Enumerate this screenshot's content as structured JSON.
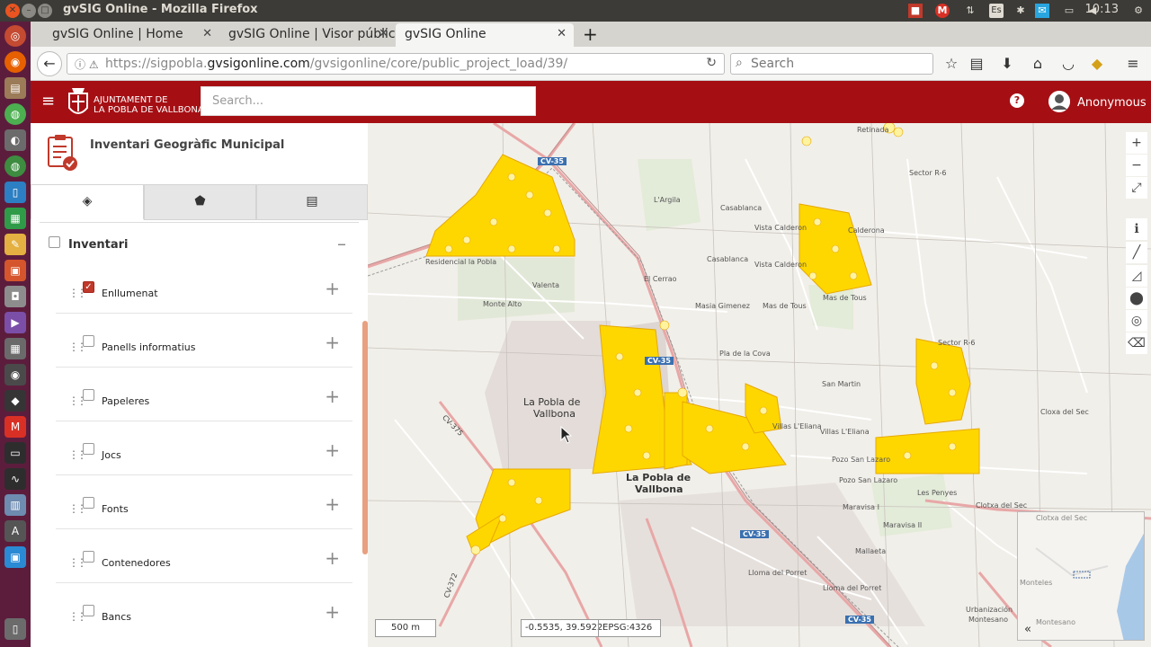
{
  "os": {
    "window_title": "gvSIG Online - Mozilla Firefox",
    "clock": "10:13",
    "keyboard_layout": "Es"
  },
  "browser": {
    "tabs": [
      {
        "label": "gvSIG Online | Home",
        "active": false
      },
      {
        "label": "gvSIG Online | Visor públic",
        "active": false
      },
      {
        "label": "gvSIG Online",
        "active": true
      }
    ],
    "url_prefix": "https://sigpobla.",
    "url_domain": "gvsigonline.com",
    "url_path": "/gvsigonline/core/public_project_load/39/",
    "search_placeholder": "Search"
  },
  "app": {
    "logo_line1": "AJUNTAMENT DE",
    "logo_line2": "LA POBLA DE VALLBONA",
    "search_placeholder": "Search...",
    "help_label": "?",
    "user_name": "Anonymous",
    "accent_color": "#a50f14"
  },
  "sidebar": {
    "project_title": "Inventari Geogràfic Municipal",
    "tabs": [
      {
        "icon": "layers-icon",
        "active": true
      },
      {
        "icon": "tags-icon",
        "active": false
      },
      {
        "icon": "list-icon",
        "active": false
      }
    ],
    "group": {
      "label": "Inventari",
      "checked": false
    },
    "layers": [
      {
        "label": "Enllumenat",
        "checked": true
      },
      {
        "label": "Panells informatius",
        "checked": false
      },
      {
        "label": "Papeleres",
        "checked": false
      },
      {
        "label": "Jocs",
        "checked": false
      },
      {
        "label": "Fonts",
        "checked": false
      },
      {
        "label": "Contenedores",
        "checked": false
      },
      {
        "label": "Bancs",
        "checked": false
      }
    ]
  },
  "map": {
    "labels": {
      "town_main": "La Pobla de",
      "town_main2": "Vallbona",
      "town_second": "La Pobla de",
      "town_second2": "Vallbona",
      "residencial": "Residencial la Pobla",
      "valenta": "Valenta",
      "monte_alto": "Monte Alto",
      "el_cerrao": "El Cerrao",
      "largila": "L'Argila",
      "casablanca1": "Casablanca",
      "casablanca2": "Casablanca",
      "vista_calderon1": "Vista Calderon",
      "vista_calderon2": "Vista Calderon",
      "calderona": "Calderona",
      "mas_de_tous1": "Mas de Tous",
      "mas_de_tous2": "Mas de Tous",
      "masia_gimenez": "Masia Gimenez",
      "pla_de_la_cova": "Pla de la Cova",
      "san_martin": "San Martin",
      "villas_leliana1": "Villas L'Eliana",
      "villas_leliana2": "Villas L'Eliana",
      "pozo_san_lazaro1": "Pozo San Lazaro",
      "pozo_san_lazaro2": "Pozo San Lazaro",
      "les_penyes": "Les Penyes",
      "maravisa1": "Maravisa I",
      "maravisa2": "Maravisa II",
      "mallaeta": "Mallaeta",
      "lloma_porret1": "Lloma del Porret",
      "lloma_porret2": "Lloma del Porret",
      "cloxa_del_sec1": "Cloxa del Sec",
      "cloxa_del_sec2": "Clotxa del Sec",
      "sector_r6": "Sector R-6",
      "sector_r62": "Sector R-6",
      "retinada": "Retinada",
      "urbanizacion": "Urbanización",
      "montesano": "Montesano",
      "cv35_a": "CV-35",
      "cv35_b": "CV-35",
      "cv35_c": "CV-35",
      "cv35_d": "CV-35",
      "cv375": "CV-375",
      "cv372": "CV-372"
    },
    "scale_label": "500 m",
    "coordinates": "-0.5535, 39.5922",
    "epsg": "EPSG:4326",
    "overview_toggle": "«",
    "overview_label1": "Clotxa del Sec",
    "overview_label2": "Monteles",
    "overview_label3": "Montesano",
    "point_color": "#ffd700",
    "point_outline": "#e6a800",
    "road_color": "#e8a7a7"
  }
}
